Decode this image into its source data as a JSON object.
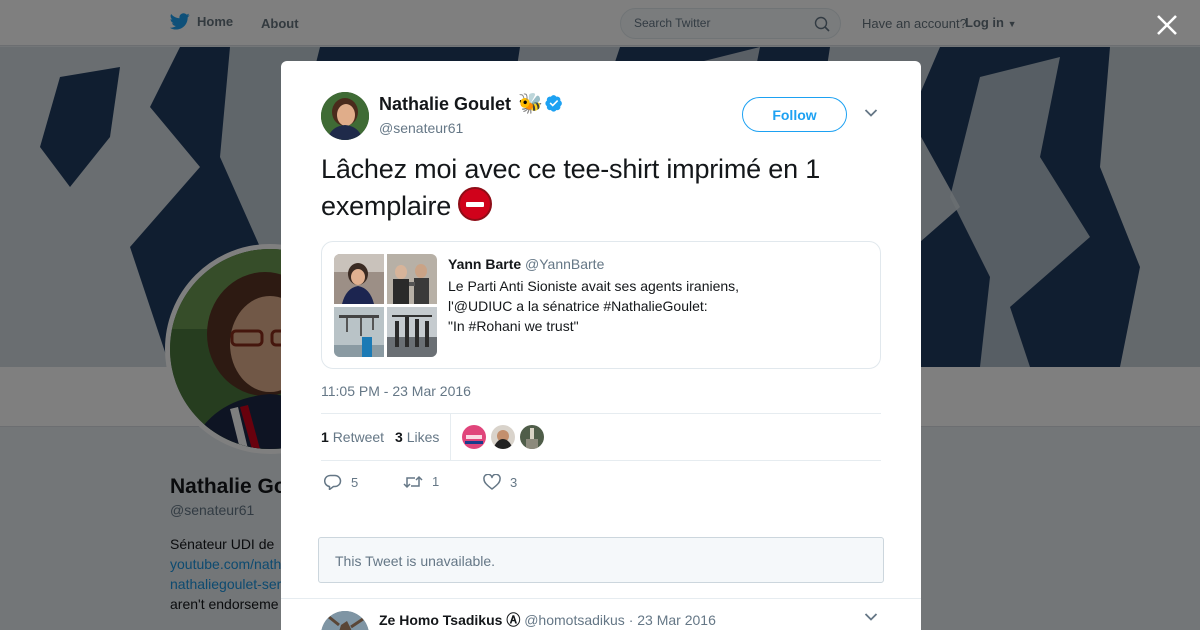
{
  "topbar": {
    "home_label": "Home",
    "about_label": "About",
    "search_placeholder": "Search Twitter",
    "have_account": "Have an account?",
    "login_label": "Log in"
  },
  "background_profile": {
    "name": "Nathalie Go",
    "handle": "@senateur61",
    "bio_line1": "Sénateur UDI de",
    "bio_link1": "youtube.com/nath",
    "bio_link2": "nathaliegoulet-ser",
    "bio_line4": "aren't endorseme"
  },
  "tweet": {
    "author_name": "Nathalie Goulet",
    "author_emoji": "🐝",
    "author_handle": "@senateur61",
    "follow_label": "Follow",
    "text": "Lâchez moi avec ce tee-shirt  imprimé en 1 exemplaire",
    "timestamp": "11:05 PM - 23 Mar 2016",
    "retweets": {
      "count": "1",
      "label": "Retweet"
    },
    "likes": {
      "count": "3",
      "label": "Likes"
    },
    "actions": {
      "replies": "5",
      "retweets": "1",
      "likes": "3"
    }
  },
  "quoted_tweet": {
    "author_name": "Yann Barte",
    "author_handle": "@YannBarte",
    "lines": [
      "Le Parti Anti Sioniste avait ses agents iraniens,",
      "l'@UDIUC a la sénatrice #NathalieGoulet:",
      "\"In #Rohani we trust\""
    ]
  },
  "unavailable_text": "This Tweet is unavailable.",
  "reply": {
    "author_name": "Ze Homo Tsadikus Ⓐ",
    "author_handle": "@homotsadikus",
    "separator": "·",
    "date": "23 Mar 2016"
  },
  "colors": {
    "accent": "#1da1f2",
    "verified": "#1da1f2",
    "banner": "#1f3a5c"
  },
  "icons": [
    "twitter-bird-icon",
    "search-icon",
    "close-icon",
    "verified-badge-icon",
    "chevron-down-icon",
    "reply-icon",
    "retweet-icon",
    "like-icon",
    "no-entry-icon"
  ]
}
